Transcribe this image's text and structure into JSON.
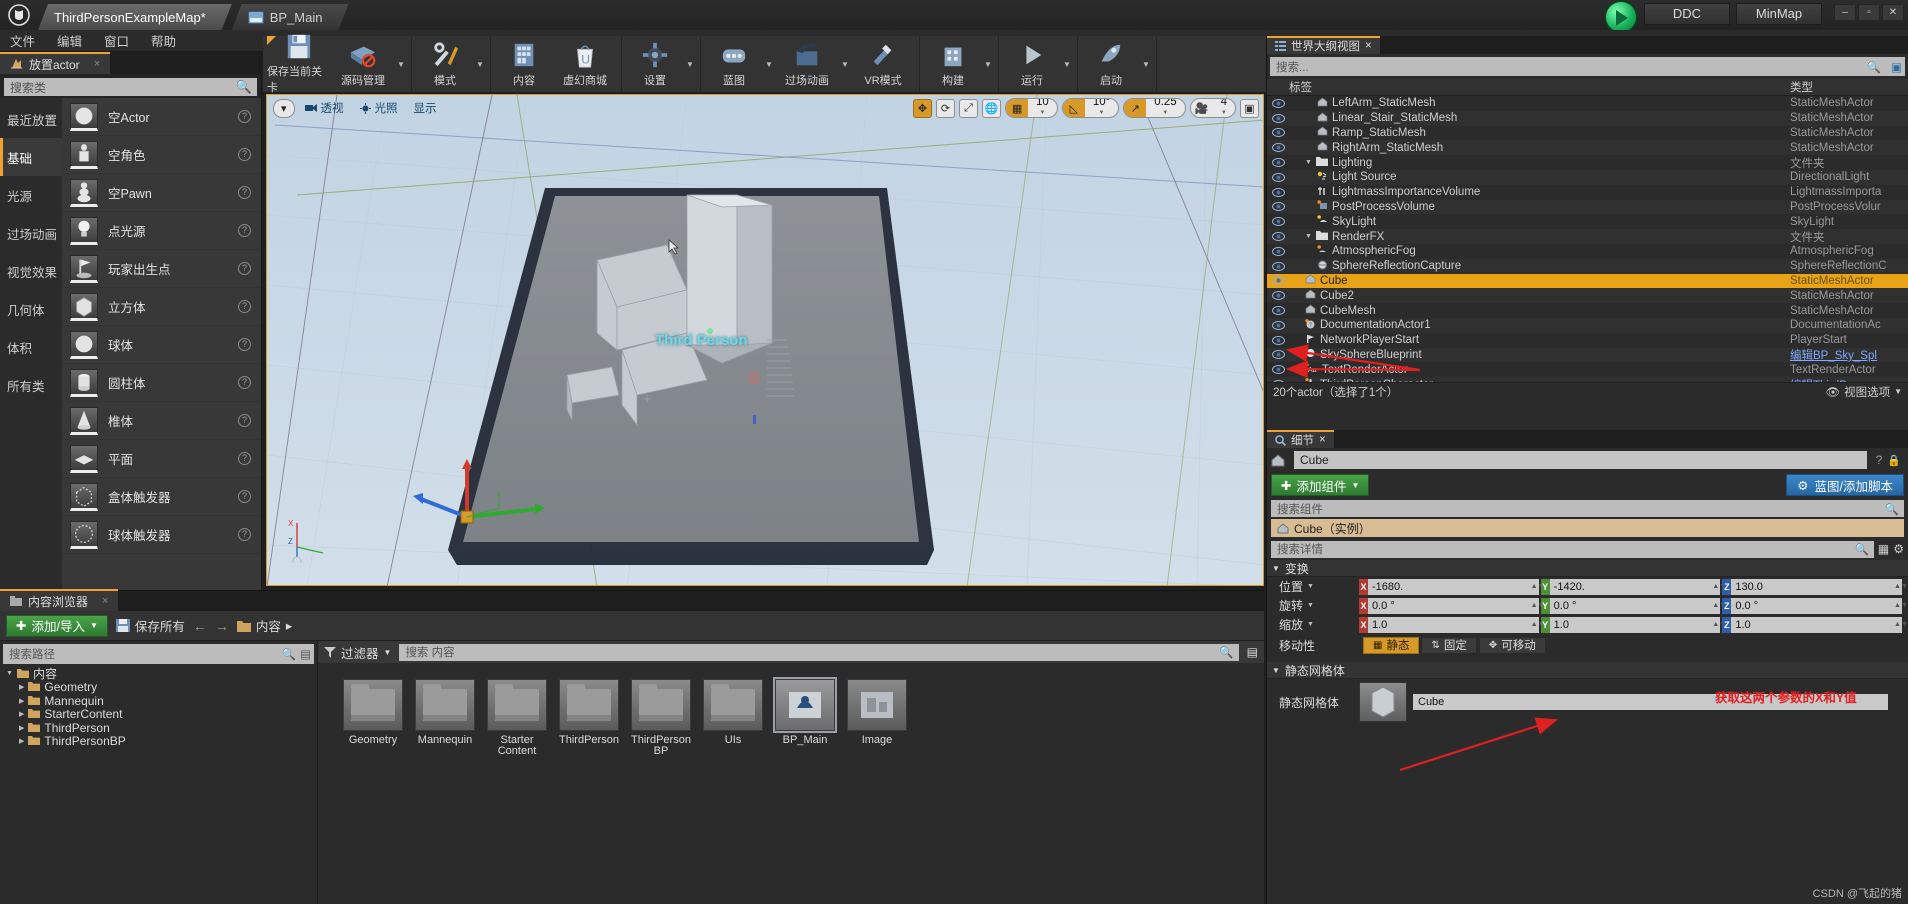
{
  "title_bar": {
    "logo": "unreal-logo",
    "tabs": [
      {
        "label": "ThirdPersonExampleMap*",
        "active": true
      },
      {
        "label": "BP_Main",
        "active": false
      }
    ],
    "right_buttons": [
      "DDC",
      "MinMap"
    ],
    "window_controls": [
      "–",
      "▫",
      "✕"
    ]
  },
  "menu_bar": {
    "items": [
      "文件",
      "编辑",
      "窗口",
      "帮助"
    ]
  },
  "place_panel": {
    "tab_label": "放置actor",
    "close": "×",
    "search_placeholder": "搜索类",
    "categories": [
      {
        "label": "最近放置",
        "selected": false
      },
      {
        "label": "基础",
        "selected": true
      },
      {
        "label": "光源",
        "selected": false
      },
      {
        "label": "过场动画",
        "selected": false
      },
      {
        "label": "视觉效果",
        "selected": false
      },
      {
        "label": "几何体",
        "selected": false
      },
      {
        "label": "体积",
        "selected": false
      },
      {
        "label": "所有类",
        "selected": false
      }
    ],
    "items": [
      {
        "label": "空Actor",
        "icon": "sphere-icon"
      },
      {
        "label": "空角色",
        "icon": "character-icon"
      },
      {
        "label": "空Pawn",
        "icon": "pawn-icon"
      },
      {
        "label": "点光源",
        "icon": "bulb-icon"
      },
      {
        "label": "玩家出生点",
        "icon": "playerstart-icon"
      },
      {
        "label": "立方体",
        "icon": "cube-icon"
      },
      {
        "label": "球体",
        "icon": "sphere-icon"
      },
      {
        "label": "圆柱体",
        "icon": "cylinder-icon"
      },
      {
        "label": "椎体",
        "icon": "cone-icon"
      },
      {
        "label": "平面",
        "icon": "plane-icon"
      },
      {
        "label": "盒体触发器",
        "icon": "box-trigger-icon"
      },
      {
        "label": "球体触发器",
        "icon": "sphere-trigger-icon"
      }
    ]
  },
  "toolbar": {
    "buttons": [
      {
        "label": "保存当前关卡",
        "icon": "floppy-save-icon",
        "dropdown": false
      },
      {
        "label": "源码管理",
        "icon": "source-control-icon",
        "dropdown": true
      },
      {
        "label": "模式",
        "icon": "modes-wrench-icon",
        "dropdown": true
      },
      {
        "label": "内容",
        "icon": "content-icon",
        "dropdown": false
      },
      {
        "label": "虚幻商城",
        "icon": "marketplace-icon",
        "dropdown": false
      },
      {
        "label": "设置",
        "icon": "settings-gear-icon",
        "dropdown": true
      },
      {
        "label": "蓝图",
        "icon": "blueprint-icon",
        "dropdown": true
      },
      {
        "label": "过场动画",
        "icon": "cinematics-icon",
        "dropdown": true
      },
      {
        "label": "VR模式",
        "icon": "vr-mode-icon",
        "dropdown": false
      },
      {
        "label": "构建",
        "icon": "build-icon",
        "dropdown": true
      },
      {
        "label": "运行",
        "icon": "play-icon",
        "dropdown": true
      },
      {
        "label": "启动",
        "icon": "launch-icon",
        "dropdown": true
      }
    ]
  },
  "viewport": {
    "left_controls": [
      {
        "label": "透视",
        "icon": "camera-icon"
      },
      {
        "label": "光照",
        "icon": "lit-icon"
      },
      {
        "label": "显示",
        "icon": "show-icon"
      }
    ],
    "right_controls": {
      "transform_icons": [
        "move-icon",
        "rotate-icon",
        "scale-icon"
      ],
      "world_icon": "globe-icon",
      "grid_snap": {
        "icon": "grid-icon",
        "value": "10",
        "active": true
      },
      "angle_snap": {
        "icon": "angle-icon",
        "value": "10°",
        "active": true
      },
      "scale_snap": {
        "icon": "scale-arrow-icon",
        "value": "0.25",
        "active": true
      },
      "camera_speed": {
        "icon": "camera-speed-icon",
        "value": "4",
        "active": false
      },
      "maximize_icon": "maximize-icon"
    },
    "scene_text": "Third Person",
    "axis_labels": [
      "X",
      "Z",
      "Y"
    ]
  },
  "content_browser": {
    "tab_label": "内容浏览器",
    "close": "×",
    "toolbar": {
      "add_import": "添加/导入",
      "save_all": "保存所有",
      "back_icon": "arrow-left-icon",
      "forward_icon": "arrow-right-icon",
      "breadcrumb": "内容",
      "breadcrumb_caret": "▸"
    },
    "left": {
      "search_placeholder": "搜索路径",
      "tree": [
        {
          "label": "内容",
          "depth": 0,
          "expanded": true,
          "icon": "folder-icon"
        },
        {
          "label": "Geometry",
          "depth": 1,
          "expanded": false,
          "icon": "folder-icon"
        },
        {
          "label": "Mannequin",
          "depth": 1,
          "expanded": false,
          "icon": "folder-icon"
        },
        {
          "label": "StarterContent",
          "depth": 1,
          "expanded": false,
          "icon": "folder-icon"
        },
        {
          "label": "ThirdPerson",
          "depth": 1,
          "expanded": false,
          "icon": "folder-icon"
        },
        {
          "label": "ThirdPersonBP",
          "depth": 1,
          "expanded": false,
          "icon": "folder-icon"
        }
      ]
    },
    "right": {
      "filter_label": "过滤器",
      "search_placeholder": "搜索 内容",
      "assets": [
        {
          "label": "Geometry",
          "type": "folder",
          "selected": false
        },
        {
          "label": "Mannequin",
          "type": "folder",
          "selected": false
        },
        {
          "label": "Starter Content",
          "type": "folder",
          "selected": false
        },
        {
          "label": "ThirdPerson",
          "type": "folder",
          "selected": false
        },
        {
          "label": "ThirdPerson BP",
          "type": "folder",
          "selected": false
        },
        {
          "label": "UIs",
          "type": "folder",
          "selected": false
        },
        {
          "label": "BP_Main",
          "type": "blueprint",
          "selected": true
        },
        {
          "label": "Image",
          "type": "texture",
          "selected": false
        }
      ]
    }
  },
  "outliner": {
    "tab_label": "世界大纲视图",
    "close": "×",
    "search_placeholder": "搜索...",
    "columns": {
      "name": "标签",
      "type": "类型"
    },
    "rows": [
      {
        "name": "LeftArm_StaticMesh",
        "type": "StaticMeshActor",
        "depth": 2,
        "icon": "mesh-icon",
        "selected": false,
        "link": false
      },
      {
        "name": "Linear_Stair_StaticMesh",
        "type": "StaticMeshActor",
        "depth": 2,
        "icon": "mesh-icon",
        "selected": false,
        "link": false
      },
      {
        "name": "Ramp_StaticMesh",
        "type": "StaticMeshActor",
        "depth": 2,
        "icon": "mesh-icon",
        "selected": false,
        "link": false
      },
      {
        "name": "RightArm_StaticMesh",
        "type": "StaticMeshActor",
        "depth": 2,
        "icon": "mesh-icon",
        "selected": false,
        "link": false
      },
      {
        "name": "Lighting",
        "type": "文件夹",
        "depth": 1,
        "icon": "folder-icon",
        "selected": false,
        "link": false
      },
      {
        "name": "Light Source",
        "type": "DirectionalLight",
        "depth": 2,
        "icon": "light-icon",
        "selected": false,
        "link": false
      },
      {
        "name": "LightmassImportanceVolume",
        "type": "LightmassImporta",
        "depth": 2,
        "icon": "volume-icon",
        "selected": false,
        "link": false
      },
      {
        "name": "PostProcessVolume",
        "type": "PostProcessVolur",
        "depth": 2,
        "icon": "postprocess-icon",
        "selected": false,
        "link": false
      },
      {
        "name": "SkyLight",
        "type": "SkyLight",
        "depth": 2,
        "icon": "skylight-icon",
        "selected": false,
        "link": false
      },
      {
        "name": "RenderFX",
        "type": "文件夹",
        "depth": 1,
        "icon": "folder-icon",
        "selected": false,
        "link": false
      },
      {
        "name": "AtmosphericFog",
        "type": "AtmosphericFog",
        "depth": 2,
        "icon": "fog-icon",
        "selected": false,
        "link": false
      },
      {
        "name": "SphereReflectionCapture",
        "type": "SphereReflectionC",
        "depth": 2,
        "icon": "reflection-icon",
        "selected": false,
        "link": false
      },
      {
        "name": "Cube",
        "type": "StaticMeshActor",
        "depth": 1,
        "icon": "mesh-icon",
        "selected": true,
        "link": false
      },
      {
        "name": "Cube2",
        "type": "StaticMeshActor",
        "depth": 1,
        "icon": "mesh-icon",
        "selected": false,
        "link": false
      },
      {
        "name": "CubeMesh",
        "type": "StaticMeshActor",
        "depth": 1,
        "icon": "mesh-icon",
        "selected": false,
        "link": false
      },
      {
        "name": "DocumentationActor1",
        "type": "DocumentationAc",
        "depth": 1,
        "icon": "doc-icon",
        "selected": false,
        "link": false
      },
      {
        "name": "NetworkPlayerStart",
        "type": "PlayerStart",
        "depth": 1,
        "icon": "playerstart-icon",
        "selected": false,
        "link": false
      },
      {
        "name": "SkySphereBlueprint",
        "type": "编辑BP_Sky_Spl",
        "depth": 1,
        "icon": "sphere-icon",
        "selected": false,
        "link": true
      },
      {
        "name": "TextRenderActor",
        "type": "TextRenderActor",
        "depth": 1,
        "icon": "text-icon",
        "selected": false,
        "link": false
      },
      {
        "name": "ThirdPersonCharacter",
        "type": "编辑ThirdPerson",
        "depth": 1,
        "icon": "character-icon",
        "selected": false,
        "link": true
      }
    ],
    "footer": {
      "count_text": "20个actor（选择了1个）",
      "view_options": "视图选项",
      "eye_icon": "eye-icon"
    }
  },
  "details": {
    "tab_label": "细节",
    "close": "×",
    "actor_name": "Cube",
    "help_icon": "question-icon",
    "add_component_button": "添加组件",
    "blueprint_button": "蓝图/添加脚本",
    "search_component_placeholder": "搜索组件",
    "component_row": "Cube（实例）",
    "search_details_placeholder": "搜索详情",
    "transform": {
      "section_label": "变换",
      "rows": [
        {
          "label": "位置",
          "dropdown": true,
          "x": "-1680.",
          "y": "-1420.",
          "z": "130.0"
        },
        {
          "label": "旋转",
          "dropdown": true,
          "x": "0.0 °",
          "y": "0.0 °",
          "z": "0.0 °"
        },
        {
          "label": "缩放",
          "dropdown": true,
          "x": "1.0",
          "y": "1.0",
          "z": "1.0"
        }
      ],
      "mobility": {
        "label": "移动性",
        "options": [
          {
            "label": "静态",
            "active": true,
            "icon": "static-icon"
          },
          {
            "label": "固定",
            "active": false,
            "icon": "stationary-icon"
          },
          {
            "label": "可移动",
            "active": false,
            "icon": "movable-icon"
          }
        ]
      }
    },
    "static_mesh": {
      "section_label": "静态网格体",
      "row_label": "静态网格体",
      "value": "Cube"
    }
  },
  "annotations": {
    "transform_note": "获取这两个参数的X和Y值",
    "color": "#e02020"
  },
  "watermark": "CSDN @飞起的猪"
}
